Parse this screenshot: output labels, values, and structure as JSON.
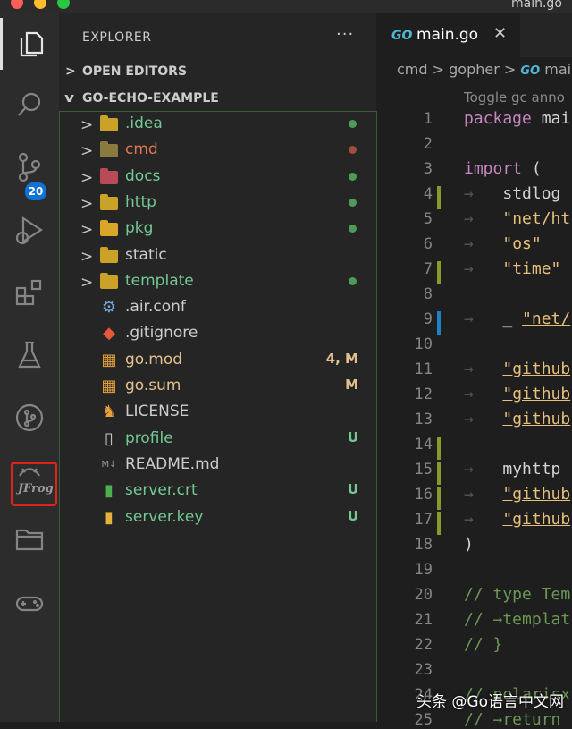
{
  "window": {
    "title": "main.go"
  },
  "sidebar": {
    "title": "EXPLORER",
    "more_label": "···",
    "sections": [
      {
        "label": "OPEN EDITORS",
        "chevron": ">"
      },
      {
        "label": "GO-ECHO-EXAMPLE",
        "chevron": "v"
      }
    ],
    "files": [
      {
        "name": ".idea",
        "type": "folder",
        "chevron": ">",
        "color": "#73c991",
        "status": "dot",
        "status_color": "#4e9a59",
        "icon_color": "#c9a227"
      },
      {
        "name": "cmd",
        "type": "folder",
        "chevron": ">",
        "color": "#e0764f",
        "status": "dot",
        "status_color": "#a14d3a",
        "icon_color": "#8a7a40"
      },
      {
        "name": "docs",
        "type": "folder",
        "chevron": ">",
        "color": "#73c991",
        "status": "dot",
        "status_color": "#4e9a59",
        "icon_color": "#b94a58"
      },
      {
        "name": "http",
        "type": "folder",
        "chevron": ">",
        "color": "#73c991",
        "status": "dot",
        "status_color": "#4e9a59",
        "icon_color": "#c9a227"
      },
      {
        "name": "pkg",
        "type": "folder",
        "chevron": ">",
        "color": "#73c991",
        "status": "dot",
        "status_color": "#4e9a59",
        "icon_color": "#d9a62a"
      },
      {
        "name": "static",
        "type": "folder",
        "chevron": ">",
        "color": "#cccccc",
        "status": "",
        "status_color": "",
        "icon_color": "#c9a227"
      },
      {
        "name": "template",
        "type": "folder",
        "chevron": ">",
        "color": "#73c991",
        "status": "dot",
        "status_color": "#4e9a59",
        "icon_color": "#c9a227"
      },
      {
        "name": ".air.conf",
        "type": "file",
        "chevron": "",
        "color": "#cccccc",
        "status": "",
        "status_color": "",
        "icon": "gear-icon",
        "icon_color": "#6fa8dc"
      },
      {
        "name": ".gitignore",
        "type": "file",
        "chevron": "",
        "color": "#cccccc",
        "status": "",
        "status_color": "",
        "icon": "git-icon",
        "icon_color": "#e8573a"
      },
      {
        "name": "go.mod",
        "type": "file",
        "chevron": "",
        "color": "#e2c08d",
        "status": "4, M",
        "status_color": "#e2c08d",
        "icon": "go-mod-icon",
        "icon_color": "#e3a03a"
      },
      {
        "name": "go.sum",
        "type": "file",
        "chevron": "",
        "color": "#e2c08d",
        "status": "M",
        "status_color": "#e2c08d",
        "icon": "go-sum-icon",
        "icon_color": "#e3a03a"
      },
      {
        "name": "LICENSE",
        "type": "file",
        "chevron": "",
        "color": "#cccccc",
        "status": "",
        "status_color": "",
        "icon": "license-icon",
        "icon_color": "#e8a23a"
      },
      {
        "name": "profile",
        "type": "file",
        "chevron": "",
        "color": "#73c991",
        "status": "U",
        "status_color": "#73c991",
        "icon": "file-icon",
        "icon_color": "#cccccc"
      },
      {
        "name": "README.md",
        "type": "file",
        "chevron": "",
        "color": "#cccccc",
        "status": "",
        "status_color": "",
        "icon": "markdown-icon",
        "icon_color": "#999999"
      },
      {
        "name": "server.crt",
        "type": "file",
        "chevron": "",
        "color": "#73c991",
        "status": "U",
        "status_color": "#73c991",
        "icon": "certificate-icon",
        "icon_color": "#4caf50"
      },
      {
        "name": "server.key",
        "type": "file",
        "chevron": "",
        "color": "#73c991",
        "status": "U",
        "status_color": "#73c991",
        "icon": "key-icon",
        "icon_color": "#e3b23a"
      }
    ]
  },
  "activity_bar": {
    "items": [
      "explorer-icon",
      "search-icon",
      "source-control-icon",
      "run-debug-icon",
      "extensions-icon",
      "testing-icon",
      "git-graph-icon",
      "jfrog-icon",
      "remote-explorer-icon",
      "gamepad-icon"
    ],
    "scm_badge": "20",
    "jfrog_label": "JFrog"
  },
  "editor": {
    "tab": {
      "icon_text": "GO",
      "label": "main.go",
      "close": "✕"
    },
    "breadcrumb": {
      "part1": "cmd",
      "sep": ">",
      "part2": "gopher",
      "part3_icon": "GO",
      "part3": "mai"
    },
    "codelens": "Toggle gc anno",
    "lines": [
      {
        "n": "1",
        "segments": [
          {
            "t": "package",
            "c": "kw"
          },
          {
            "t": " mai",
            "c": ""
          }
        ]
      },
      {
        "n": "2",
        "segments": []
      },
      {
        "n": "3",
        "segments": [
          {
            "t": "import",
            "c": "kw"
          },
          {
            "t": " (",
            "c": ""
          }
        ]
      },
      {
        "n": "4",
        "segments": [
          {
            "t": "→   ",
            "c": "arrow"
          },
          {
            "t": "stdlog",
            "c": ""
          }
        ]
      },
      {
        "n": "5",
        "segments": [
          {
            "t": "→   ",
            "c": "arrow"
          },
          {
            "t": "\"net/ht",
            "c": "str"
          }
        ]
      },
      {
        "n": "6",
        "segments": [
          {
            "t": "→   ",
            "c": "arrow"
          },
          {
            "t": "\"os\"",
            "c": "str"
          }
        ]
      },
      {
        "n": "7",
        "segments": [
          {
            "t": "→   ",
            "c": "arrow"
          },
          {
            "t": "\"time\"",
            "c": "str"
          }
        ]
      },
      {
        "n": "8",
        "segments": []
      },
      {
        "n": "9",
        "segments": [
          {
            "t": "→   ",
            "c": "arrow"
          },
          {
            "t": "_ ",
            "c": ""
          },
          {
            "t": "\"net/",
            "c": "str"
          }
        ]
      },
      {
        "n": "10",
        "segments": []
      },
      {
        "n": "11",
        "segments": [
          {
            "t": "→   ",
            "c": "arrow"
          },
          {
            "t": "\"github",
            "c": "str"
          }
        ]
      },
      {
        "n": "12",
        "segments": [
          {
            "t": "→   ",
            "c": "arrow"
          },
          {
            "t": "\"github",
            "c": "str"
          }
        ]
      },
      {
        "n": "13",
        "segments": [
          {
            "t": "→   ",
            "c": "arrow"
          },
          {
            "t": "\"github",
            "c": "str"
          }
        ]
      },
      {
        "n": "14",
        "segments": []
      },
      {
        "n": "15",
        "segments": [
          {
            "t": "→   ",
            "c": "arrow"
          },
          {
            "t": "myhttp",
            "c": ""
          }
        ]
      },
      {
        "n": "16",
        "segments": [
          {
            "t": "→   ",
            "c": "arrow"
          },
          {
            "t": "\"github",
            "c": "str"
          }
        ]
      },
      {
        "n": "17",
        "segments": [
          {
            "t": "→   ",
            "c": "arrow"
          },
          {
            "t": "\"github",
            "c": "str"
          }
        ]
      },
      {
        "n": "18",
        "segments": [
          {
            "t": ")",
            "c": ""
          }
        ]
      },
      {
        "n": "19",
        "segments": []
      },
      {
        "n": "20",
        "segments": [
          {
            "t": "// type Tem",
            "c": "cmt"
          }
        ]
      },
      {
        "n": "21",
        "segments": [
          {
            "t": "// →templat",
            "c": "cmt"
          }
        ]
      },
      {
        "n": "22",
        "segments": [
          {
            "t": "// }",
            "c": "cmt"
          }
        ]
      },
      {
        "n": "23",
        "segments": []
      },
      {
        "n": "24",
        "segments": [
          {
            "t": "// polarisxu",
            "c": "cmt"
          }
        ]
      },
      {
        "n": "25",
        "segments": [
          {
            "t": "// →return",
            "c": "cmt"
          }
        ]
      }
    ],
    "gutter_marks": [
      {
        "line": "4",
        "color": "#8a9a2a"
      },
      {
        "line": "7",
        "color": "#8a9a2a"
      },
      {
        "line": "9",
        "color": "#1b80c4"
      },
      {
        "line": "14",
        "color": "#8a9a2a"
      },
      {
        "line": "15",
        "color": "#8a9a2a"
      },
      {
        "line": "16",
        "color": "#8a9a2a"
      },
      {
        "line": "17",
        "color": "#8a9a2a"
      }
    ]
  },
  "watermark": "头条 @Go语言中文网"
}
